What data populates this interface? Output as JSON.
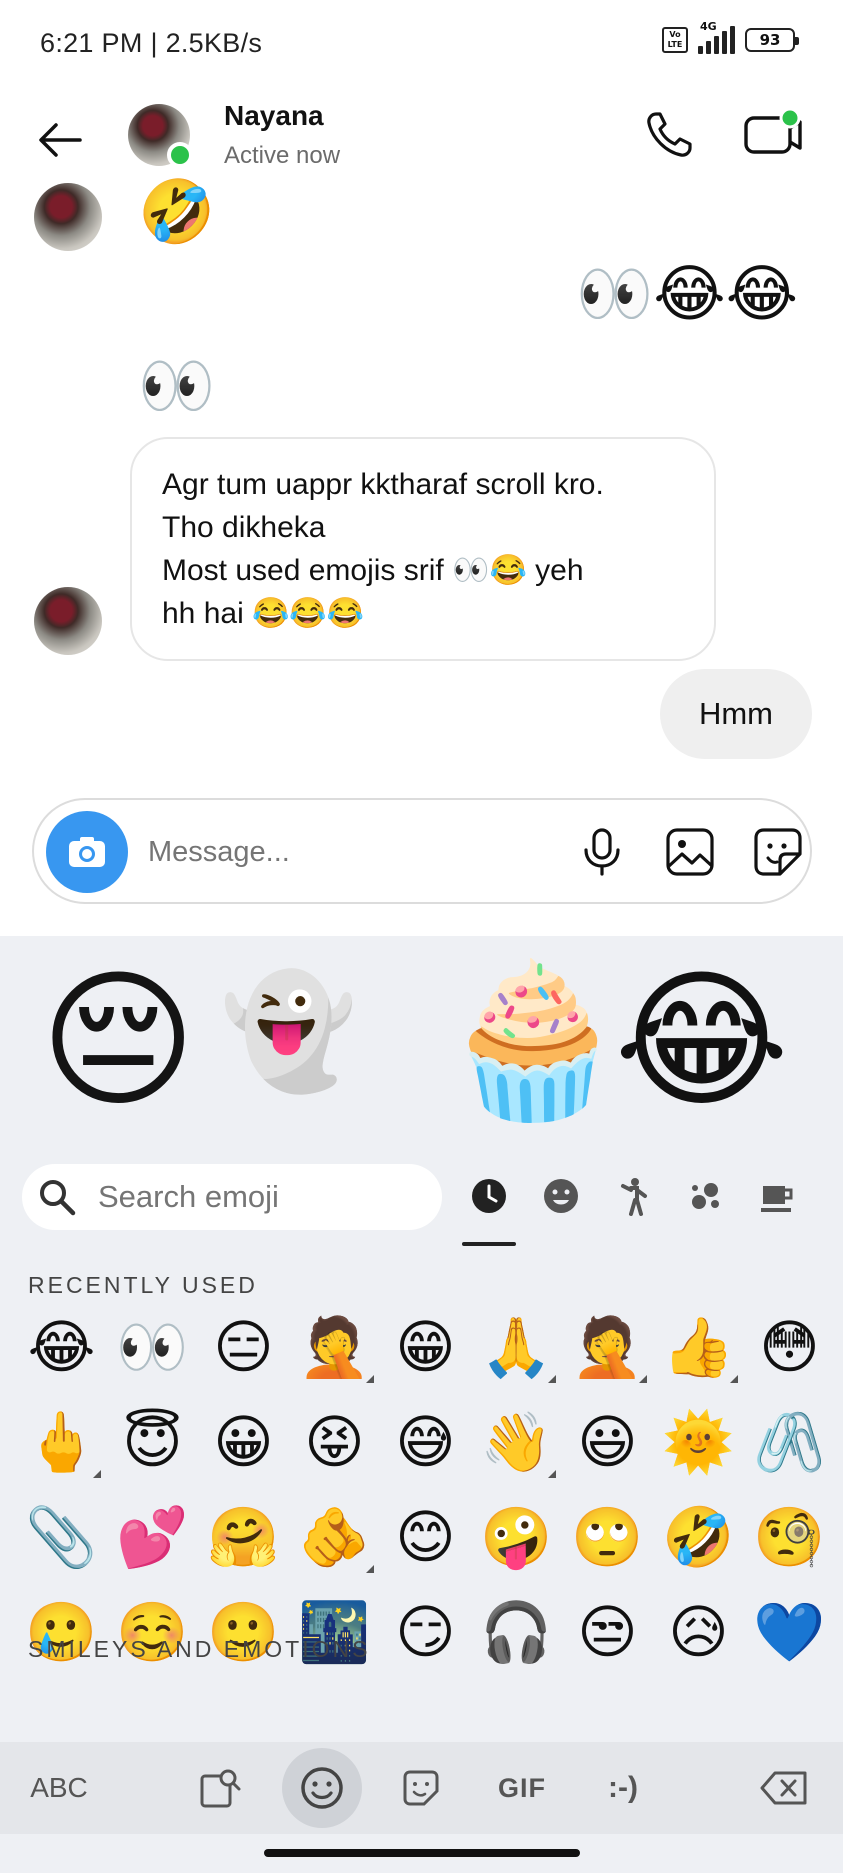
{
  "status_bar": {
    "time": "6:21 PM | 2.5KB/s",
    "network": "4G",
    "battery": "93"
  },
  "header": {
    "name": "Nayana",
    "status": "Active now"
  },
  "chat": {
    "incoming_emoji_1": "🤣",
    "outgoing_emojis": "👀😂😂",
    "incoming_emoji_2": "👀",
    "incoming_message": {
      "line1": "Agr tum uappr kktharaf scroll kro.",
      "line2": "Tho dikheka",
      "line3_text": "Most used emojis srif ",
      "line3_emojis": "👀😂",
      "line3_end": " yeh",
      "line4_text": "hh hai ",
      "line4_emojis": "😂😂😂"
    },
    "outgoing_message": "Hmm"
  },
  "composer": {
    "placeholder": "Message..."
  },
  "keyboard": {
    "stickers": [
      "😔",
      "👻",
      "🧁",
      "😂"
    ],
    "search_placeholder": "Search emoji",
    "category_tabs": [
      "recent-icon",
      "smiley-icon",
      "person-icon",
      "nature-icon",
      "food-icon"
    ],
    "recently_used_label": "RECENTLY USED",
    "recent_emojis": [
      "😂",
      "👀",
      "😑",
      "🤦",
      "😁",
      "🙏",
      "🤦",
      "👍",
      "😳",
      "🖕",
      "😇",
      "😀",
      "😝",
      "😅",
      "👋",
      "😃",
      "🌞",
      "🖇️",
      "📎",
      "💕",
      "🤗",
      "🫵",
      "😊",
      "🤪",
      "🙄",
      "🤣",
      "🧐",
      "🥲",
      "☺️",
      "🙂",
      "🌃",
      "😏",
      "🎧",
      "😒",
      "😥",
      "💙"
    ],
    "smileys_label": "SMILEYS AND EMOTIONS",
    "bottom": {
      "abc": "ABC",
      "gif": "GIF",
      "emoticon": ":-)"
    }
  },
  "colors": {
    "accent_blue": "#3897f0",
    "online_green": "#2bc24a",
    "keyboard_bg": "#eef0f4"
  }
}
